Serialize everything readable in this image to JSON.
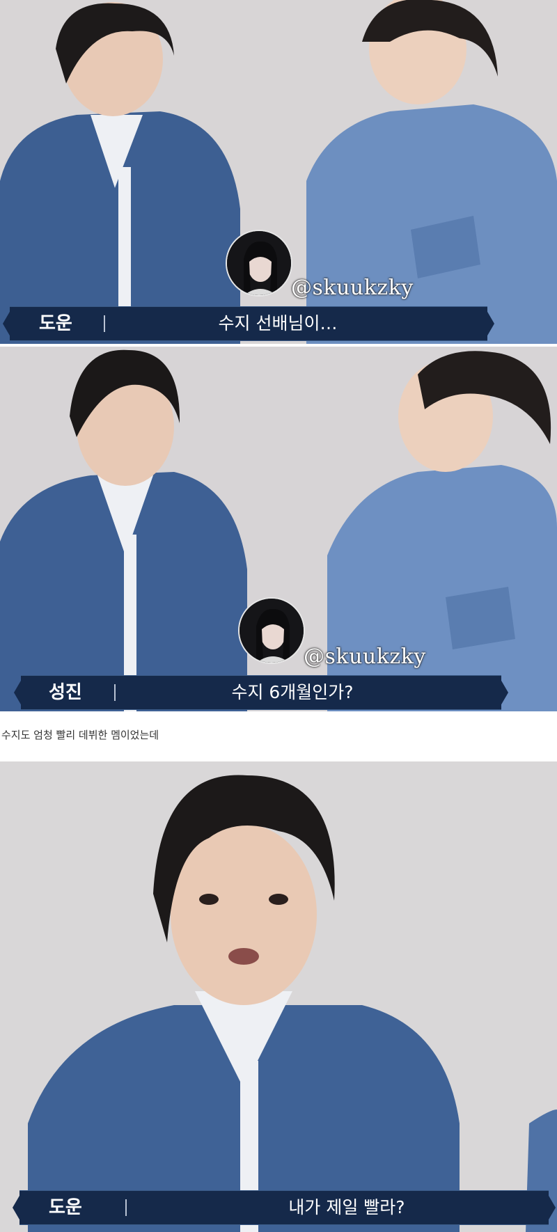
{
  "panels": [
    {
      "speaker": "도운",
      "subtitle": "수지 선배님이…",
      "handle": "@skuukzky"
    },
    {
      "speaker": "성진",
      "subtitle": "수지 6개월인가?",
      "handle": "@skuukzky"
    },
    {
      "speaker": "도운",
      "subtitle": "내가 제일 빨라?"
    }
  ],
  "caption": "수지도 엄청 빨리 데뷔한 멤이었는데",
  "colors": {
    "subtitle_bar": "#15294a",
    "backdrop": "#d9d6d7",
    "denim": "#5a7db0"
  }
}
